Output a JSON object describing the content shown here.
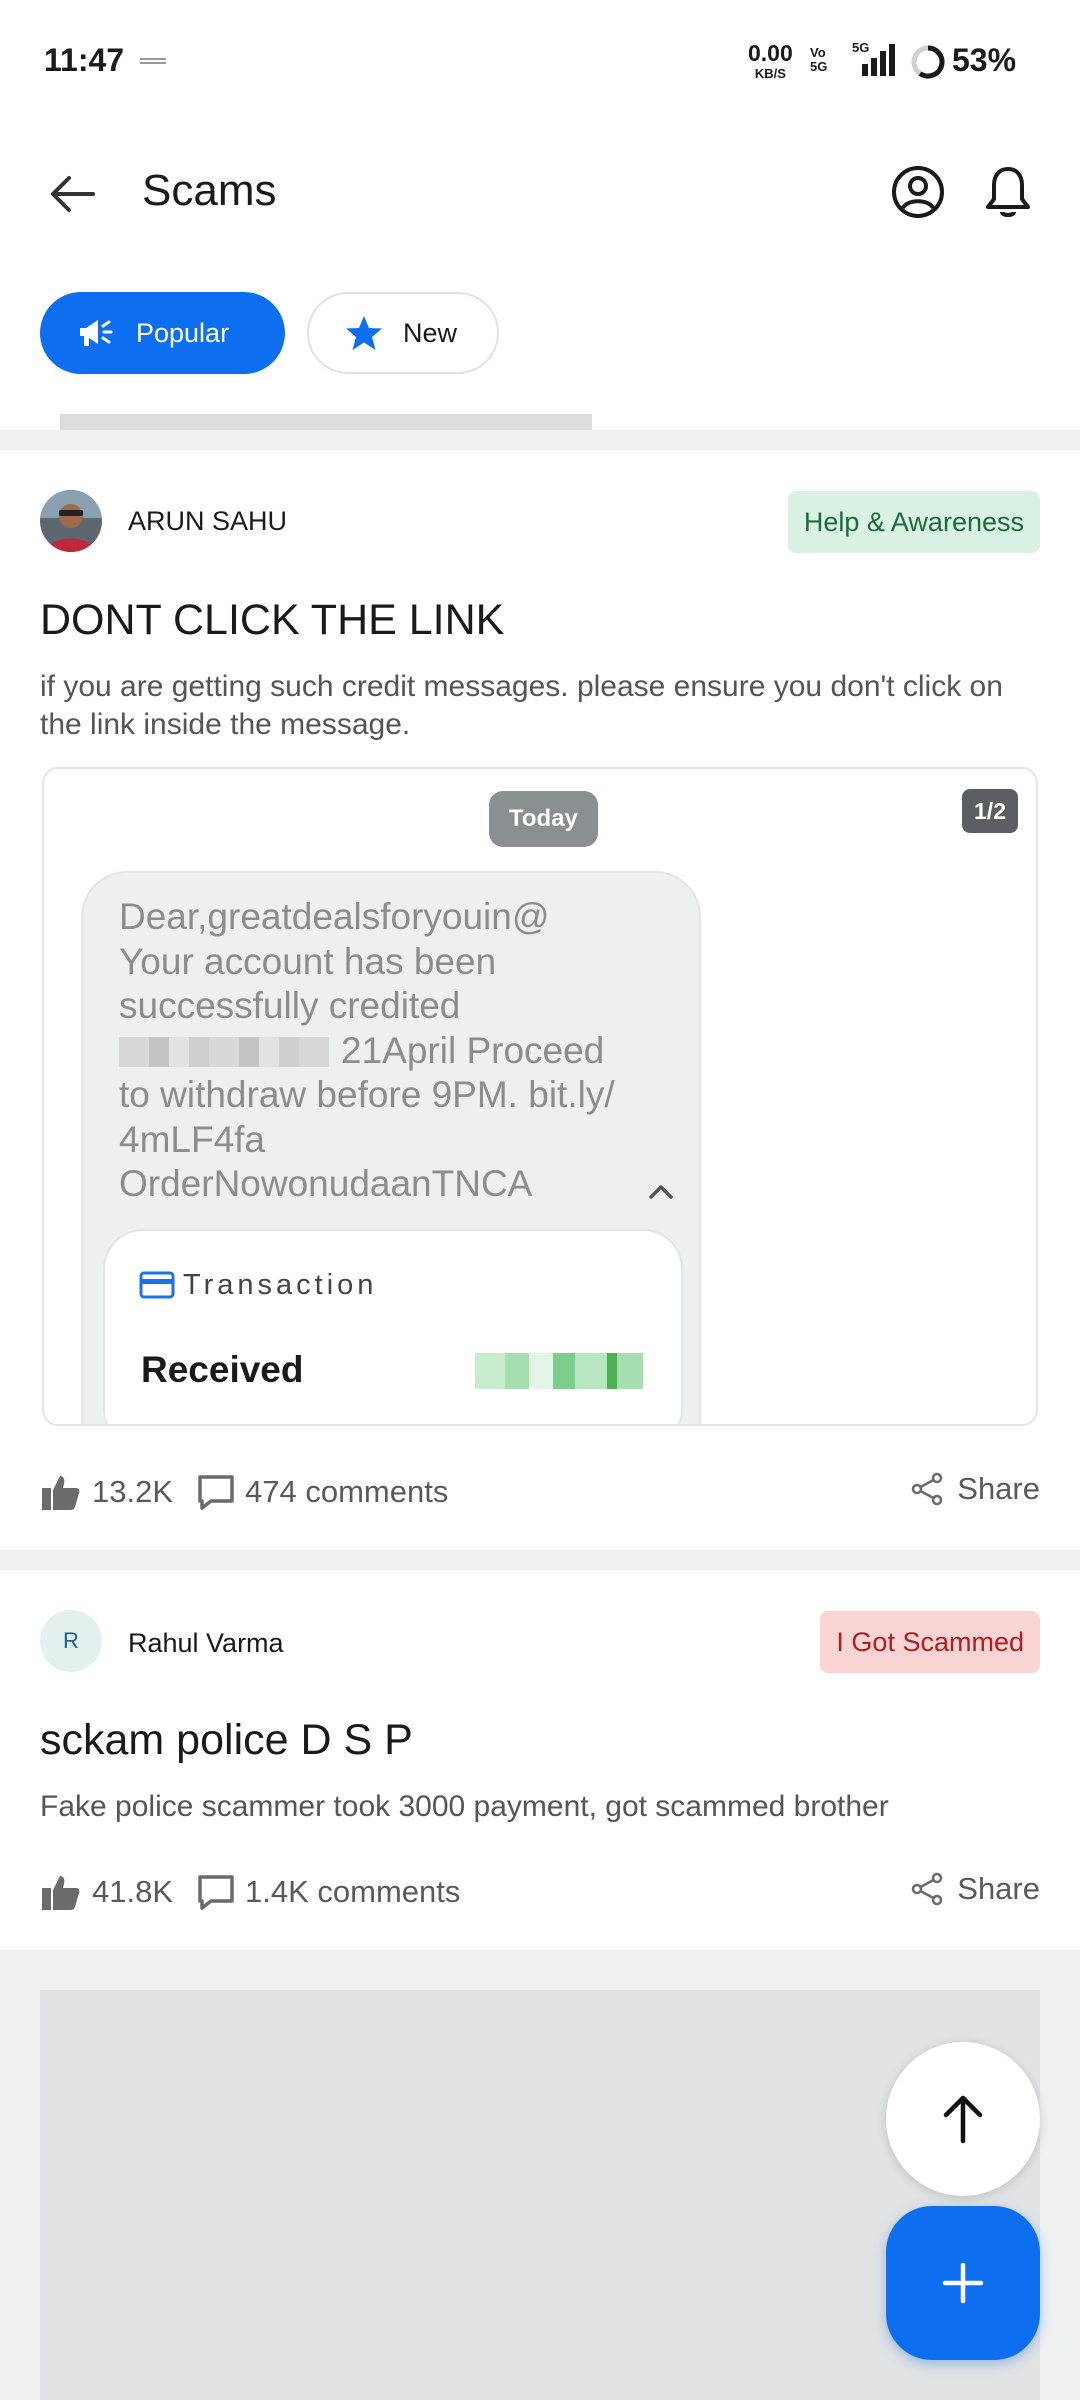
{
  "status_bar": {
    "time": "11:47",
    "net_speed": "0.00",
    "net_unit": "KB/S",
    "vo_top": "Vo",
    "vo_bottom": "5G",
    "signal_type": "5G",
    "battery": "53%"
  },
  "header": {
    "title": "Scams",
    "back_icon": "arrow-left-icon",
    "profile_icon": "user-circle-icon",
    "notifications_icon": "bell-icon"
  },
  "tabs": [
    {
      "label": "Popular",
      "icon": "megaphone-icon",
      "active": true
    },
    {
      "label": "New",
      "icon": "star-icon",
      "active": false
    }
  ],
  "posts": [
    {
      "author": "ARUN SAHU",
      "tag": "Help & Awareness",
      "title": "DONT CLICK THE LINK",
      "body": "if you are getting such credit messages. please ensure you don't click on the link inside the message.",
      "media": {
        "date_chip": "Today",
        "pager": "1/2",
        "message_line1": "Dear,greatdealsforyouin@",
        "message_line2": "Your account has been",
        "message_line3": "successfully credited",
        "message_line4": "21April Proceed",
        "message_line5": "to withdraw before 9PM. bit.ly/",
        "message_line6": "4mLF4fa",
        "message_line7": "OrderNowonudaanTNCA",
        "transaction_label": "Transaction",
        "received_label": "Received"
      },
      "likes": "13.2K",
      "comments": "474 comments",
      "share": "Share"
    },
    {
      "author": "Rahul Varma",
      "avatar_letter": "R",
      "tag": "I Got Scammed",
      "title": "sckam police D S  P",
      "body": "Fake police scammer took 3000 payment, got scammed brother",
      "likes": "41.8K",
      "comments": "1.4K comments",
      "share": "Share"
    }
  ],
  "colors": {
    "accent": "#0d6ef0",
    "tag_green_bg": "#d9f2e3",
    "tag_red_bg": "#fbd4d4"
  },
  "fabs": {
    "scroll_top_icon": "arrow-up-icon",
    "add_icon": "plus-icon"
  }
}
